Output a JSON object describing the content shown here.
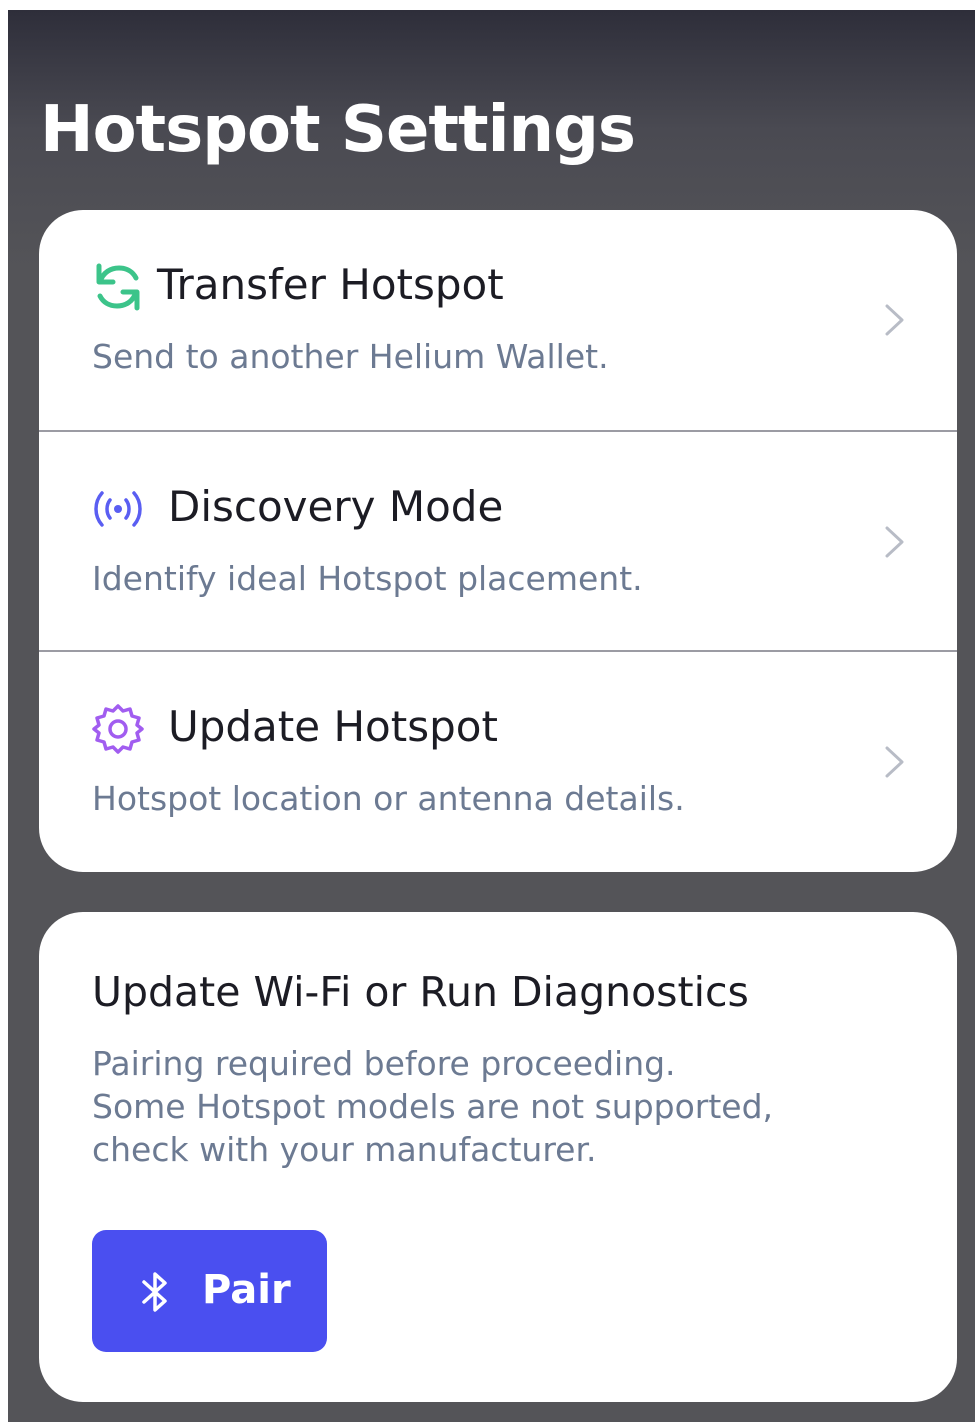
{
  "header": {
    "title": "Hotspot Settings"
  },
  "menu": {
    "items": [
      {
        "title": "Transfer Hotspot",
        "subtitle": "Send to another Helium Wallet.",
        "icon": "transfer-icon",
        "icon_color": "#3cc48a"
      },
      {
        "title": "Discovery Mode",
        "subtitle": "Identify ideal Hotspot placement.",
        "icon": "broadcast-icon",
        "icon_color": "#5a5ef2"
      },
      {
        "title": "Update Hotspot",
        "subtitle": "Hotspot location or antenna details.",
        "icon": "gear-icon",
        "icon_color": "#a15df0"
      }
    ]
  },
  "diagnostics": {
    "title": "Update Wi-Fi or Run Diagnostics",
    "description_lines": [
      "Pairing required before proceeding.",
      "Some Hotspot models are not supported,",
      "check with your manufacturer."
    ],
    "button": {
      "label": "Pair",
      "icon": "bluetooth-icon",
      "color": "#4a4ff0"
    }
  },
  "colors": {
    "background": "#545458",
    "card": "#ffffff",
    "title_text": "#1c1c24",
    "subtitle_text": "#6c7a92"
  }
}
